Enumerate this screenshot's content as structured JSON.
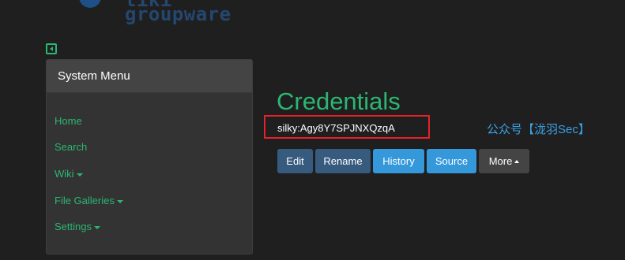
{
  "logo": {
    "line1": "tiki",
    "line2": "groupware"
  },
  "sidebar": {
    "heading": "System Menu",
    "items": [
      {
        "label": "Home",
        "has_dropdown": false
      },
      {
        "label": "Search",
        "has_dropdown": false
      },
      {
        "label": "Wiki",
        "has_dropdown": true
      },
      {
        "label": "File Galleries",
        "has_dropdown": true
      },
      {
        "label": "Settings",
        "has_dropdown": true
      }
    ]
  },
  "main": {
    "title": "Credentials",
    "content": "silky:Agy8Y7SPJNXQzqA",
    "watermark": "公众号【泷羽Sec】",
    "buttons": {
      "edit": "Edit",
      "rename": "Rename",
      "history": "History",
      "source": "Source",
      "more": "More"
    }
  },
  "icons": {
    "collapse": "collapse-left-icon",
    "dropdown": "caret-down-icon",
    "more": "caret-up-icon"
  },
  "colors": {
    "background": "#1f1f1f",
    "accent_green": "#2bb673",
    "primary_button": "#375a7f",
    "info_button": "#3498db",
    "secondary_button": "#444444",
    "highlight_box": "#e5212c",
    "watermark": "#3aa0e6"
  }
}
